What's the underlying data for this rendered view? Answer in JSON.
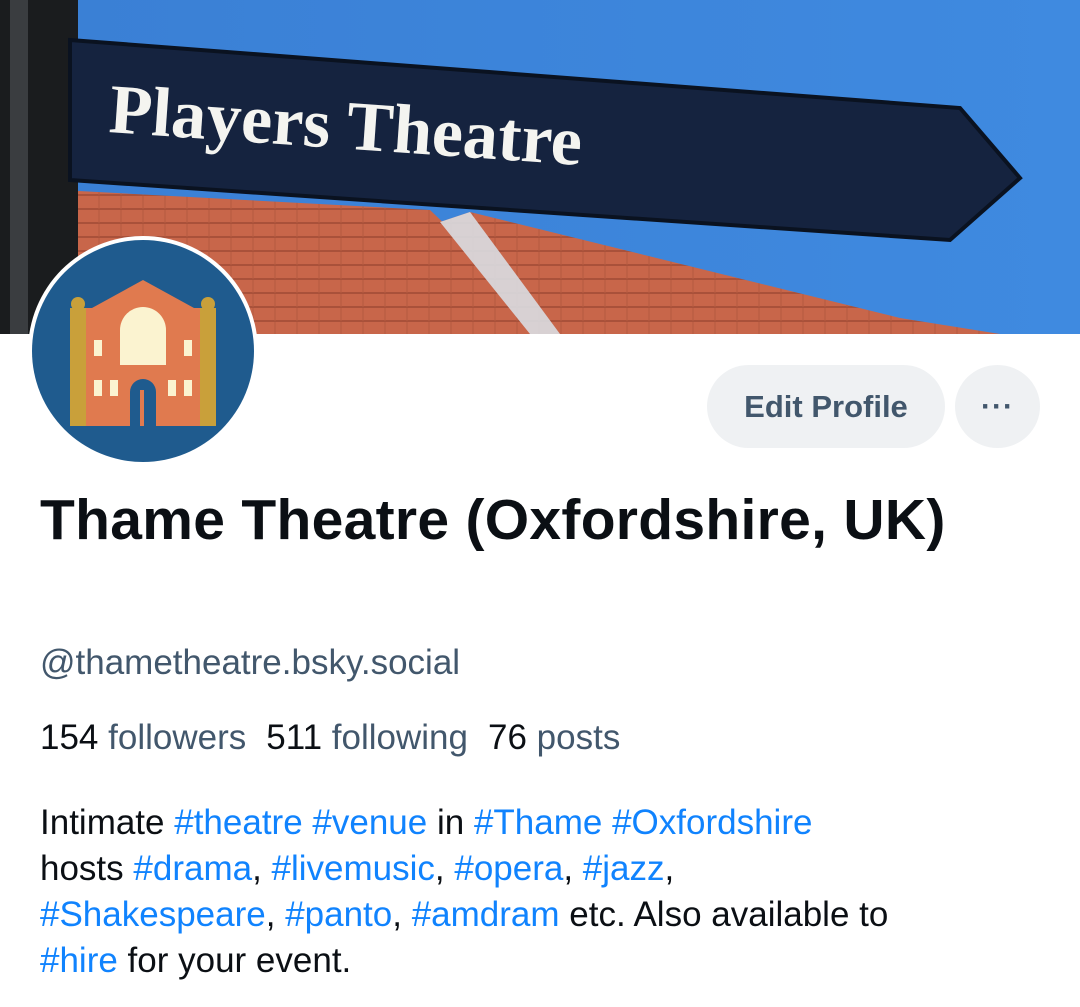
{
  "banner": {
    "sign_text": "Players Theatre",
    "sky_color": "#3f86d8",
    "sign_color": "#15233f",
    "roof_color": "#c8664a"
  },
  "avatar": {
    "bg_color": "#1f5b8e",
    "building_color": "#e07a4f"
  },
  "actions": {
    "edit_label": "Edit Profile",
    "more_label": "···"
  },
  "profile": {
    "display_name": "Thame Theatre (Oxfordshire, UK)",
    "handle": "@thametheatre.bsky.social"
  },
  "stats": {
    "followers_count": "154",
    "followers_label": "followers",
    "following_count": "511",
    "following_label": "following",
    "posts_count": "76",
    "posts_label": "posts"
  },
  "bio": {
    "t0": "Intimate ",
    "h_theatre": "#theatre",
    "t1": " ",
    "h_venue": "#venue",
    "t2": " in ",
    "h_thame": "#Thame",
    "t3": " ",
    "h_oxfordshire": "#Oxfordshire",
    "t4": " hosts ",
    "h_drama": "#drama",
    "t5": ", ",
    "h_livemusic": "#livemusic",
    "t6": ", ",
    "h_opera": "#opera",
    "t7": ", ",
    "h_jazz": "#jazz",
    "t8": ", ",
    "h_shakespeare": "#Shakespeare",
    "t9": ", ",
    "h_panto": "#panto",
    "t10": ", ",
    "h_amdram": "#amdram",
    "t11": " etc. Also available to ",
    "h_hire": "#hire",
    "t12": " for your event."
  },
  "colors": {
    "link": "#1083fe",
    "muted": "#42576c",
    "text": "#0b0f14"
  }
}
